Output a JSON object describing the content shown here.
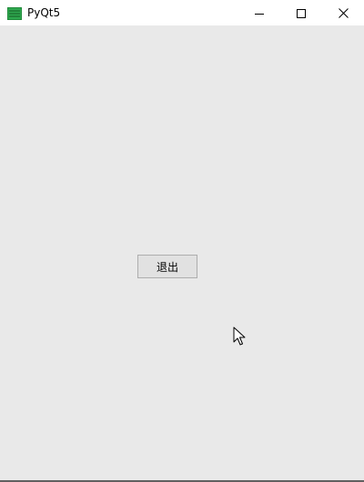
{
  "window": {
    "title": "PyQt5",
    "app_icon": "pyqt-app-icon",
    "controls": {
      "minimize_icon": "minimize-icon",
      "maximize_icon": "maximize-icon",
      "close_icon": "close-icon"
    }
  },
  "main": {
    "exit_button_label": "退出"
  },
  "cursor": {
    "icon": "mouse-pointer-icon"
  },
  "colors": {
    "titlebar_bg": "#ffffff",
    "client_bg": "#ebebeb",
    "button_bg": "#e1e1e1",
    "button_border": "#adadad",
    "app_icon_green": "#1f8a3a"
  }
}
